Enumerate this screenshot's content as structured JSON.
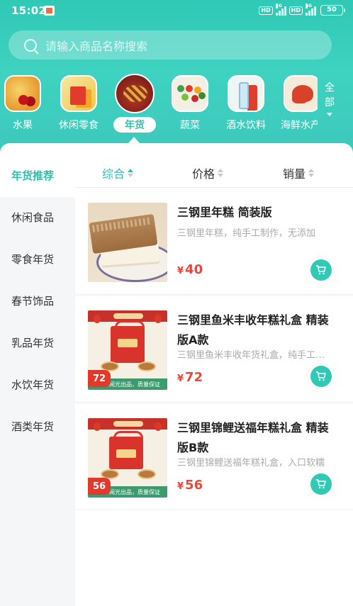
{
  "status_bar": {
    "time": "15:02",
    "hd1": "HD",
    "net1": "4G",
    "hd2": "HD",
    "net2": "4G",
    "battery": "50"
  },
  "search": {
    "placeholder": "请输入商品名称搜索"
  },
  "categories": [
    {
      "label": "水果",
      "icon": "fruit-image"
    },
    {
      "label": "休闲零食",
      "icon": "snack-image"
    },
    {
      "label": "年货",
      "icon": "new-year-goods-image",
      "active": true
    },
    {
      "label": "蔬菜",
      "icon": "vegetable-image"
    },
    {
      "label": "酒水饮料",
      "icon": "drink-image"
    },
    {
      "label": "海鲜水产",
      "icon": "seafood-image"
    }
  ],
  "all_categories": {
    "label": "全部"
  },
  "sidebar": {
    "items": [
      {
        "label": "年货推荐",
        "active": true
      },
      {
        "label": "休闲食品"
      },
      {
        "label": "零食年货"
      },
      {
        "label": "春节饰品"
      },
      {
        "label": "乳品年货"
      },
      {
        "label": "水饮年货"
      },
      {
        "label": "酒类年货"
      }
    ]
  },
  "sort_tabs": [
    {
      "label": "综合",
      "active": true
    },
    {
      "label": "价格"
    },
    {
      "label": "销量"
    }
  ],
  "products": [
    {
      "name": "三钢里年糕 简装版",
      "desc": "三钢里年糕，纯手工制作，无添加",
      "currency": "¥",
      "price": "40"
    },
    {
      "name": "三钢里鱼米丰收年糕礼盒 精装版A款",
      "desc": "三钢里鱼米丰收年货礼盒，纯手工制作",
      "currency": "¥",
      "price": "72",
      "thumb_price": "72",
      "thumb_footer": "阅光出品，质量保证"
    },
    {
      "name": "三钢里锦鲤送福年糕礼盒 精装版B款",
      "desc": "三钢里锦鲤送福年糕礼盒，入口软糯",
      "currency": "¥",
      "price": "56",
      "thumb_price": "56",
      "thumb_footer": "阅光出品，质量保证"
    }
  ],
  "colors": {
    "accent": "#2fc9b6",
    "price": "#e8473a",
    "sidebar_bg": "#f4f6f8"
  }
}
